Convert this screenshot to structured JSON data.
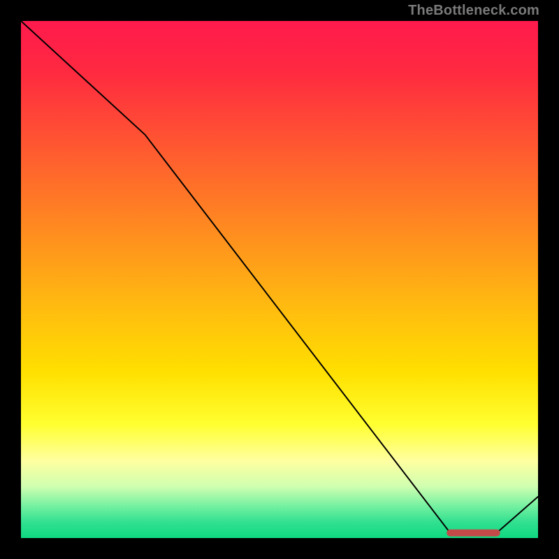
{
  "watermark": "TheBottleneck.com",
  "chart_data": {
    "type": "line",
    "x": [
      0.0,
      0.24,
      0.83,
      0.92,
      1.0
    ],
    "values": [
      1.0,
      0.78,
      0.01,
      0.01,
      0.08
    ],
    "highlight": {
      "x": [
        0.83,
        0.92
      ],
      "y": [
        0.01,
        0.01
      ]
    },
    "xlim": [
      0,
      1
    ],
    "ylim": [
      0,
      1
    ],
    "title": "",
    "xlabel": "",
    "ylabel": "",
    "legend": false,
    "grid": false
  }
}
